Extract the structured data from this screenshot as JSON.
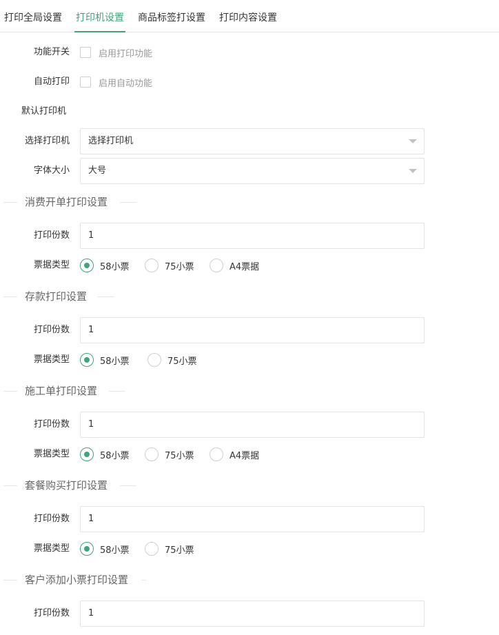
{
  "tabs": [
    {
      "label": "打印全局设置"
    },
    {
      "label": "打印机设置"
    },
    {
      "label": "商品标签打设置"
    },
    {
      "label": "打印内容设置"
    }
  ],
  "general": {
    "function_switch_label": "功能开关",
    "enable_print_text": "启用打印功能",
    "auto_print_label": "自动打印",
    "enable_auto_text": "启用自动功能",
    "default_printer_label": "默认打印机",
    "select_printer_label": "选择打印机",
    "select_printer_value": "选择打印机",
    "font_size_label": "字体大小",
    "font_size_value": "大号"
  },
  "common": {
    "copies_label": "打印份数",
    "ticket_type_label": "票据类型",
    "opt_58": "58小票",
    "opt_75": "75小票",
    "opt_a4": "A4票据"
  },
  "sections": {
    "consumption": {
      "title": "消费开单打印设置",
      "copies": "1",
      "selected": "58小票"
    },
    "deposit": {
      "title": "存款打印设置",
      "copies": "1",
      "selected": "58小票"
    },
    "work_order": {
      "title": "施工单打印设置",
      "copies": "1",
      "selected": "58小票"
    },
    "package": {
      "title": "套餐购买打印设置",
      "copies": "1",
      "selected": "58小票"
    },
    "customer": {
      "title": "客户添加小票打印设置",
      "copies": "1"
    }
  },
  "colors": {
    "accent": "#3fa57a",
    "border": "#e3e3e3",
    "muted": "#999999"
  }
}
